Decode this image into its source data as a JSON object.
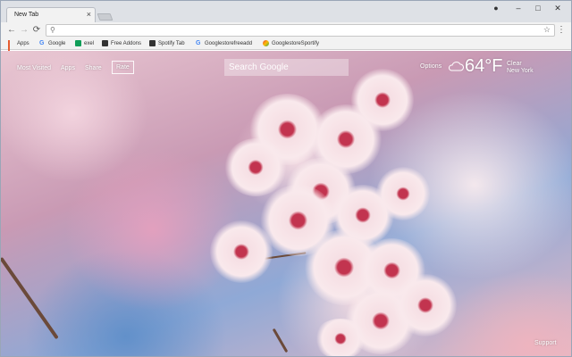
{
  "tab": {
    "title": "New Tab",
    "close": "×"
  },
  "window_controls": {
    "profile": "●",
    "minimize": "–",
    "maximize": "□",
    "close": "✕"
  },
  "toolbar": {
    "back": "←",
    "forward": "→",
    "reload": "⟳",
    "address_value": "",
    "bookmark_star": "☆",
    "menu": "⋮"
  },
  "bookmarks": [
    {
      "label": "Apps",
      "icon": "apps-grid-icon"
    },
    {
      "label": "Google",
      "icon": "google-icon"
    },
    {
      "label": "exel",
      "icon": "sheets-icon"
    },
    {
      "label": "Free Addons",
      "icon": "film-icon"
    },
    {
      "label": "Spotify Tab",
      "icon": "film-icon"
    },
    {
      "label": "Googlestorefreeadd",
      "icon": "google-icon"
    },
    {
      "label": "GooglestoreSportify",
      "icon": "rainbow-icon"
    }
  ],
  "newtab": {
    "nav": [
      "Most Visited",
      "Apps",
      "Share",
      "Rate"
    ],
    "search_placeholder": "Search Google",
    "options": "Options",
    "weather": {
      "temp": "64°F",
      "condition": "Clear",
      "location": "New York",
      "icon": "cloud-icon"
    },
    "support": "Support"
  }
}
